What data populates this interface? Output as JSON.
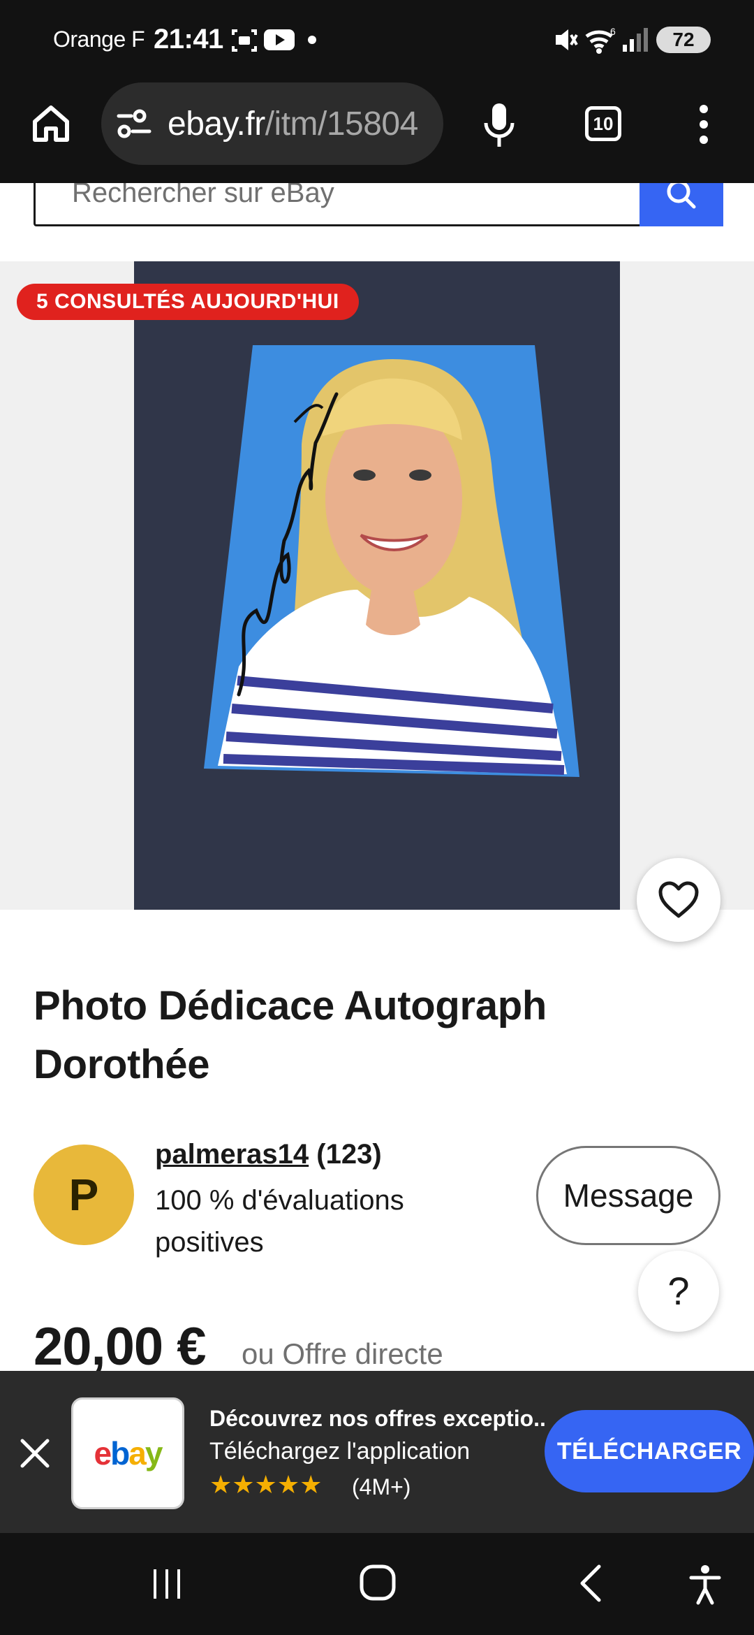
{
  "status_bar": {
    "carrier": "Orange F",
    "time": "21:41",
    "battery": "72",
    "icons": [
      "screenshot-icon",
      "youtube-icon",
      "dot-icon",
      "mute-icon",
      "wifi-icon",
      "signal-icon"
    ]
  },
  "browser": {
    "url_domain": "ebay.fr",
    "url_path": "/itm/15804",
    "tab_count": "10"
  },
  "search": {
    "placeholder": "Rechercher sur eBay"
  },
  "gallery": {
    "views_badge": "5 CONSULTÉS AUJOURD'HUI",
    "signature": "Amitiés Dorothée"
  },
  "listing": {
    "title": "Photo Dédicace Autograph Dorothée",
    "price": "20,00 €",
    "price_alt": "ou Offre directe"
  },
  "seller": {
    "initial": "P",
    "name": "palmeras14",
    "count": "(123)",
    "rating": "100 % d'évaluations positives",
    "message_label": "Message",
    "help_label": "?"
  },
  "app_banner": {
    "title": "Découvrez nos offres exceptio...",
    "subtitle": "Téléchargez l'application",
    "stars": "★★★★★",
    "count": "(4M+)",
    "download_label": "TÉLÉCHARGER",
    "logo": [
      "e",
      "b",
      "a",
      "y"
    ]
  },
  "colors": {
    "accent": "#3665f3",
    "badge": "#e0221e",
    "avatar": "#e8b83a"
  }
}
